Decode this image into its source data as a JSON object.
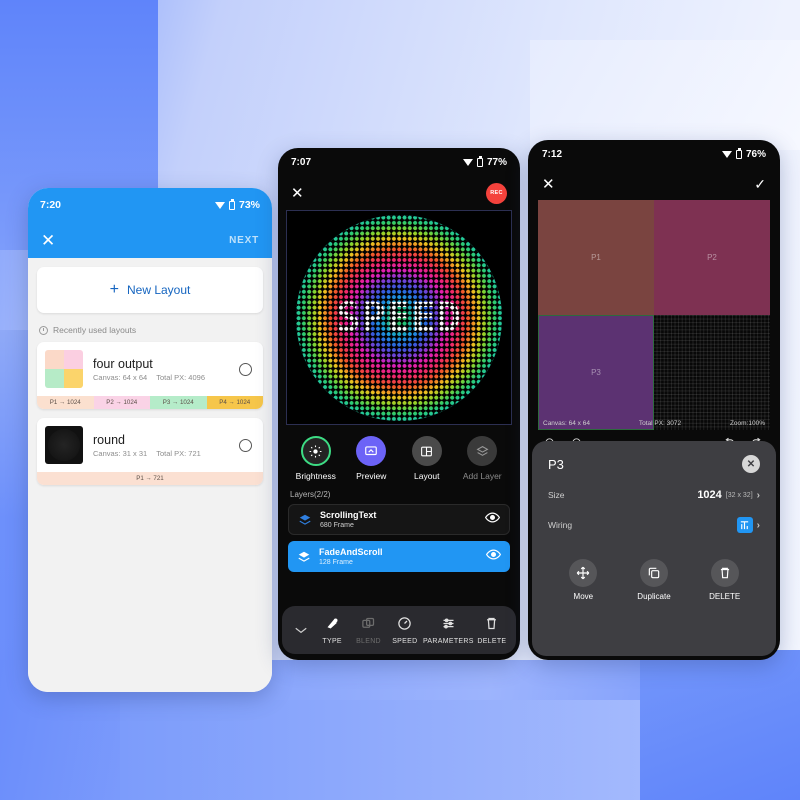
{
  "background": {
    "accent": "#6a8dfb",
    "light": "#eef2fe"
  },
  "phone1": {
    "status": {
      "time": "7:20",
      "battery": "73%",
      "wifi_icon": "wifi-icon",
      "battery_icon": "battery-icon"
    },
    "appbar": {
      "close_icon": "close-icon",
      "close_glyph": "✕",
      "next_label": "NEXT"
    },
    "new_layout": {
      "label": "New Layout",
      "plus_glyph": "+",
      "icon": "plus-icon"
    },
    "recent_label": "Recently used layouts",
    "layouts": [
      {
        "name": "four output",
        "canvas": "Canvas: 64 x 64",
        "total": "Total PX: 4096",
        "thumb_colors": [
          "#fbd9c8",
          "#fbcfe1",
          "#b6ebc7",
          "#fbd46b"
        ],
        "chips": [
          {
            "label": "P1 → 1024",
            "color": "#fbe0cf"
          },
          {
            "label": "P2 → 1024",
            "color": "#fad3e6"
          },
          {
            "label": "P3 → 1024",
            "color": "#b5ecc9"
          },
          {
            "label": "P4 → 1024",
            "color": "#f6c64a"
          }
        ]
      },
      {
        "name": "round",
        "canvas": "Canvas: 31 x 31",
        "total": "Total PX: 721",
        "chips": [
          {
            "label": "P1 → 721",
            "color": "#fbe0d2"
          }
        ]
      }
    ]
  },
  "phone2": {
    "status": {
      "time": "7:07",
      "battery": "77%"
    },
    "appbar": {
      "close_glyph": "✕",
      "rec_label": "REC",
      "rec_color": "#f4423c"
    },
    "preview": {
      "led_text": "SPEED",
      "canvas_border": "#2c2f52"
    },
    "tools": [
      {
        "label": "Brightness",
        "icon": "brightness-icon",
        "style": "ring",
        "ring_color": "#3ddc84"
      },
      {
        "label": "Preview",
        "icon": "preview-icon",
        "style": "filled",
        "fill_color": "#6c63f7"
      },
      {
        "label": "Layout",
        "icon": "layout-icon",
        "style": "grey"
      },
      {
        "label": "Add Layer",
        "icon": "add-layer-icon",
        "style": "grey-dim"
      }
    ],
    "layers_header": "Layers(2/2)",
    "layers": [
      {
        "name": "ScrollingText",
        "frames": "680 Frame",
        "selected": false,
        "eye_icon": "eye-icon"
      },
      {
        "name": "FadeAndScroll",
        "frames": "128 Frame",
        "selected": true,
        "eye_icon": "eye-icon"
      }
    ],
    "bottom_bar": [
      {
        "label": "",
        "icon": "chevron-down-icon",
        "dim": false
      },
      {
        "label": "TYPE",
        "icon": "type-icon",
        "dim": false
      },
      {
        "label": "BLEND",
        "icon": "blend-icon",
        "dim": true
      },
      {
        "label": "SPEED",
        "icon": "speed-icon",
        "dim": false
      },
      {
        "label": "PARAMETERS",
        "icon": "parameters-icon",
        "dim": false
      },
      {
        "label": "DELETE",
        "icon": "delete-icon",
        "dim": false
      }
    ]
  },
  "phone3": {
    "status": {
      "time": "7:12",
      "battery": "76%"
    },
    "appbar": {
      "close_glyph": "✕",
      "confirm_glyph": "✓"
    },
    "canvas": {
      "panels": [
        {
          "id": "P1",
          "color": "#7a4440"
        },
        {
          "id": "P2",
          "color": "#7e3152"
        },
        {
          "id": "P3",
          "color": "#5c3272"
        }
      ],
      "info": {
        "canvas": "Canvas: 64 x 64",
        "total": "Total PX: 3072",
        "zoom": "Zoom:100%"
      }
    },
    "toolbar_icons": [
      "target-icon",
      "target-icon",
      "undo-icon",
      "redo-icon"
    ],
    "sheet": {
      "title": "P3",
      "close_glyph": "✕",
      "rows": [
        {
          "label": "Size",
          "value": "1024",
          "dim_value": "[32 x 32]",
          "chevron": "›"
        },
        {
          "label": "Wiring",
          "value": "",
          "icon": "wiring-icon",
          "chevron": "›"
        }
      ],
      "actions": [
        {
          "label": "Move",
          "icon": "move-icon"
        },
        {
          "label": "Duplicate",
          "icon": "duplicate-icon"
        },
        {
          "label": "DELETE",
          "icon": "delete-icon"
        }
      ]
    }
  }
}
